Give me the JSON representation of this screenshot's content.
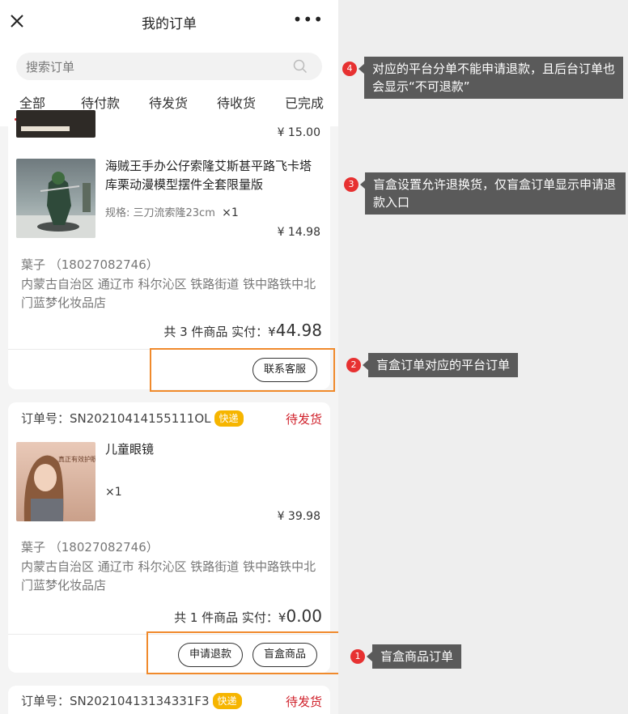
{
  "header": {
    "title": "我的订单"
  },
  "search": {
    "placeholder": "搜索订单"
  },
  "tabs": [
    {
      "label": "全部",
      "active": true
    },
    {
      "label": "待付款"
    },
    {
      "label": "待发货"
    },
    {
      "label": "待收货"
    },
    {
      "label": "已完成"
    }
  ],
  "order1": {
    "prev_price": "¥ 15.00",
    "product": {
      "title": "海贼王手办公仔索隆艾斯甚平路飞卡塔库栗动漫模型摆件全套限量版",
      "spec": "规格: 三刀流索隆23cm",
      "qty": "×1",
      "price": "¥ 14.98"
    },
    "consignee": "葉子 （18027082746）",
    "address": "内蒙古自治区 通辽市 科尔沁区 铁路街道 铁中路铁中北门蓝梦化妆品店",
    "total_prefix": "共 3 件商品 实付：¥",
    "total_amount": "44.98",
    "button_contact": "联系客服"
  },
  "order2": {
    "order_no": "订单号：SN20210414155111OL",
    "badge": "快递",
    "status": "待发货",
    "product": {
      "title": "儿童眼镜",
      "qty": "×1",
      "price": "¥ 39.98",
      "image_text": "真正有效护眼"
    },
    "consignee": "葉子 （18027082746）",
    "address": "内蒙古自治区 通辽市 科尔沁区 铁路街道 铁中路铁中北门蓝梦化妆品店",
    "total_prefix": "共 1 件商品 实付：¥",
    "total_amount": "0.00",
    "button_refund": "申请退款",
    "button_blindbox": "盲盒商品"
  },
  "order3": {
    "order_no": "订单号：SN20210413134331F3",
    "badge": "快递",
    "status": "待发货"
  },
  "annotations": [
    {
      "num": "1",
      "text": "盲盒商品订单"
    },
    {
      "num": "2",
      "text": "盲盒订单对应的平台订单"
    },
    {
      "num": "3",
      "text": "盲盒设置允许退换货，仅盲盒订单显示申请退款入口"
    },
    {
      "num": "4",
      "text": "对应的平台分单不能申请退款，且后台订单也会显示“不可退款”"
    }
  ],
  "colors": {
    "accent": "#d0212b",
    "badge": "#f6b500",
    "highlight": "#f08a2c",
    "note_bg": "#5a5a5a",
    "note_num": "#e73131"
  }
}
